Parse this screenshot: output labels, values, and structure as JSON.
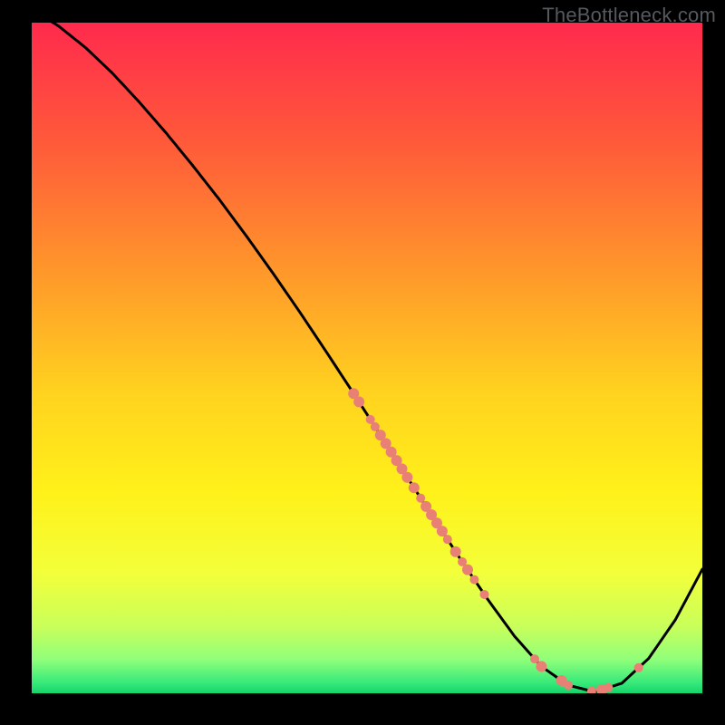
{
  "watermark": "TheBottleneck.com",
  "chart_data": {
    "type": "line",
    "title": "",
    "xlabel": "",
    "ylabel": "",
    "xlim": [
      0,
      100
    ],
    "ylim": [
      0,
      100
    ],
    "grid": false,
    "legend": false,
    "background_gradient": {
      "stops": [
        {
          "offset": 0.0,
          "color": "#ff2a4d"
        },
        {
          "offset": 0.18,
          "color": "#ff5a3a"
        },
        {
          "offset": 0.38,
          "color": "#ff9a2a"
        },
        {
          "offset": 0.55,
          "color": "#ffd21f"
        },
        {
          "offset": 0.7,
          "color": "#fff11a"
        },
        {
          "offset": 0.82,
          "color": "#f3ff3a"
        },
        {
          "offset": 0.9,
          "color": "#c9ff5a"
        },
        {
          "offset": 0.95,
          "color": "#8fff7a"
        },
        {
          "offset": 0.985,
          "color": "#35e97a"
        },
        {
          "offset": 1.0,
          "color": "#15d36a"
        }
      ]
    },
    "series": [
      {
        "name": "curve",
        "color": "#000000",
        "x": [
          0,
          4,
          8,
          12,
          16,
          20,
          24,
          28,
          32,
          36,
          40,
          44,
          48,
          52,
          56,
          60,
          64,
          68,
          72,
          76,
          80,
          84,
          88,
          92,
          96,
          100
        ],
        "y": [
          102,
          99.5,
          96.3,
          92.5,
          88.2,
          83.6,
          78.7,
          73.6,
          68.2,
          62.6,
          56.8,
          50.8,
          44.7,
          38.5,
          32.2,
          26.0,
          19.9,
          14.0,
          8.5,
          4.0,
          1.2,
          0.2,
          1.5,
          5.2,
          11.0,
          18.5
        ]
      }
    ],
    "markers": {
      "color": "#e98075",
      "points": [
        {
          "x": 48.0,
          "r": 6
        },
        {
          "x": 48.8,
          "r": 6
        },
        {
          "x": 50.5,
          "r": 5
        },
        {
          "x": 51.2,
          "r": 5
        },
        {
          "x": 52.0,
          "r": 6
        },
        {
          "x": 52.8,
          "r": 6
        },
        {
          "x": 53.6,
          "r": 6
        },
        {
          "x": 54.4,
          "r": 6
        },
        {
          "x": 55.2,
          "r": 6
        },
        {
          "x": 56.0,
          "r": 6
        },
        {
          "x": 57.0,
          "r": 6
        },
        {
          "x": 58.0,
          "r": 5
        },
        {
          "x": 58.8,
          "r": 6
        },
        {
          "x": 59.6,
          "r": 6
        },
        {
          "x": 60.4,
          "r": 6
        },
        {
          "x": 61.2,
          "r": 6
        },
        {
          "x": 62.0,
          "r": 5
        },
        {
          "x": 63.2,
          "r": 6
        },
        {
          "x": 64.2,
          "r": 5
        },
        {
          "x": 65.0,
          "r": 6
        },
        {
          "x": 66.0,
          "r": 5
        },
        {
          "x": 67.5,
          "r": 5
        },
        {
          "x": 75.0,
          "r": 5
        },
        {
          "x": 76.0,
          "r": 6
        },
        {
          "x": 79.0,
          "r": 6
        },
        {
          "x": 80.0,
          "r": 5
        },
        {
          "x": 83.5,
          "r": 5
        },
        {
          "x": 85.0,
          "r": 6
        },
        {
          "x": 86.0,
          "r": 5
        },
        {
          "x": 90.5,
          "r": 5
        }
      ]
    }
  }
}
